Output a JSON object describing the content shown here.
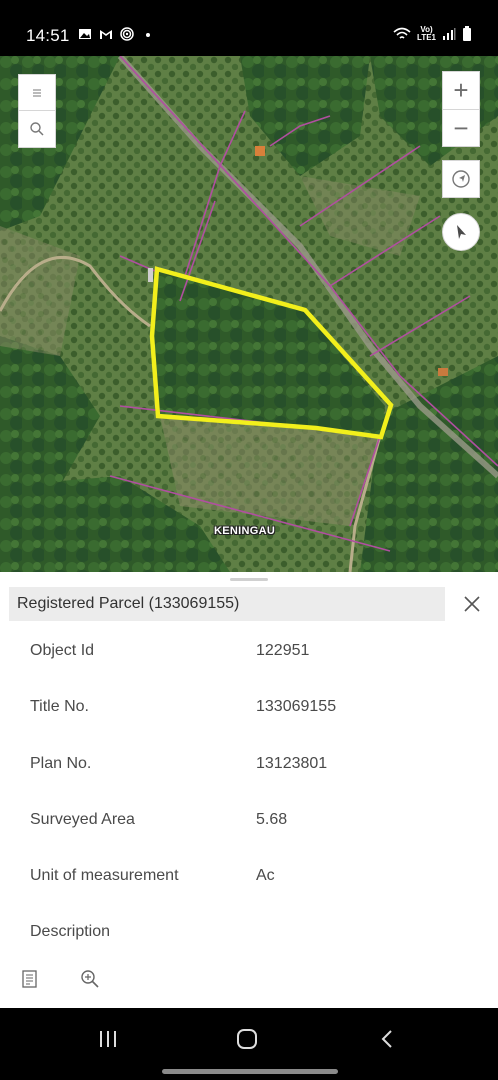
{
  "status_bar": {
    "time": "14:51",
    "left_icons": [
      "gallery-icon",
      "gmail-icon",
      "target-icon",
      "dot-icon"
    ],
    "network_label_top": "Vo)",
    "network_label_bottom": "LTE1",
    "right_icons": [
      "wifi-icon",
      "signal-icon",
      "battery-icon"
    ]
  },
  "map": {
    "place_label": "KENINGAU",
    "controls": {
      "layers_icon": "list-icon",
      "search_icon": "search-icon",
      "zoom_in": "+",
      "zoom_out": "−",
      "locate_icon": "locate-icon",
      "compass_icon": "compass-icon"
    },
    "colors": {
      "parcel_outline": "#f2ef1c",
      "boundary_lines": "#b04fa0"
    }
  },
  "panel": {
    "title": "Registered Parcel (133069155)",
    "close_icon": "close-icon",
    "attributes": [
      {
        "label": "Object Id",
        "value": "122951"
      },
      {
        "label": "Title No.",
        "value": "133069155"
      },
      {
        "label": "Plan No.",
        "value": "13123801"
      },
      {
        "label": "Surveyed Area",
        "value": "5.68"
      },
      {
        "label": "Unit of measurement",
        "value": "Ac"
      },
      {
        "label": "Description",
        "value": ""
      }
    ],
    "footer_icons": [
      "document-icon",
      "zoom-to-icon"
    ]
  },
  "nav_bar": {
    "buttons": [
      "recents-icon",
      "home-icon",
      "back-icon"
    ]
  }
}
